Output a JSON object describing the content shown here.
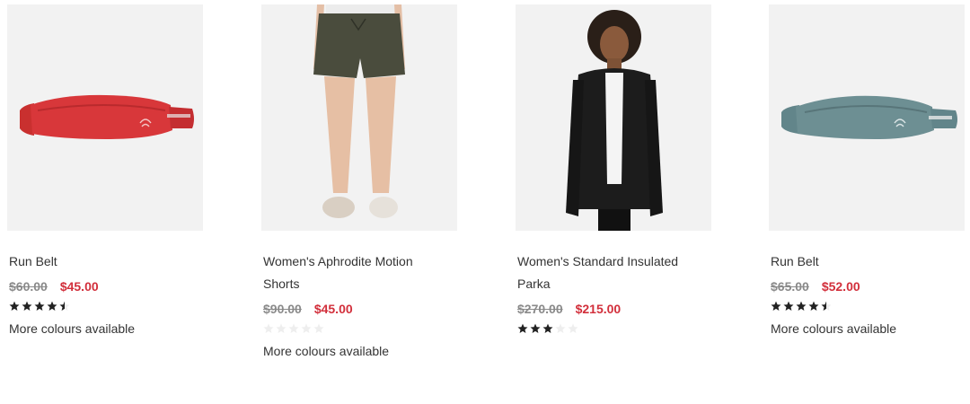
{
  "products": [
    {
      "name": "Run Belt",
      "old_price": "$60.00",
      "new_price": "$45.00",
      "rating": 4.5,
      "more_colours": "More colours available",
      "image": "red-run-belt",
      "image_color": "#d8373a"
    },
    {
      "name": "Women's Aphrodite Motion Shorts",
      "old_price": "$90.00",
      "new_price": "$45.00",
      "rating": 0,
      "more_colours": "More colours available",
      "image": "olive-shorts",
      "image_color": "#4a4c3d"
    },
    {
      "name": "Women's Standard Insulated Parka",
      "old_price": "$270.00",
      "new_price": "$215.00",
      "rating": 3,
      "more_colours": "",
      "image": "black-parka",
      "image_color": "#1c1c1c"
    },
    {
      "name": "Run Belt",
      "old_price": "$65.00",
      "new_price": "$52.00",
      "rating": 4.5,
      "more_colours": "More colours available",
      "image": "teal-run-belt",
      "image_color": "#6d8f93"
    }
  ],
  "colors": {
    "sale_red": "#d22f3b",
    "star_filled": "#222222",
    "star_empty": "#eeeeee"
  }
}
